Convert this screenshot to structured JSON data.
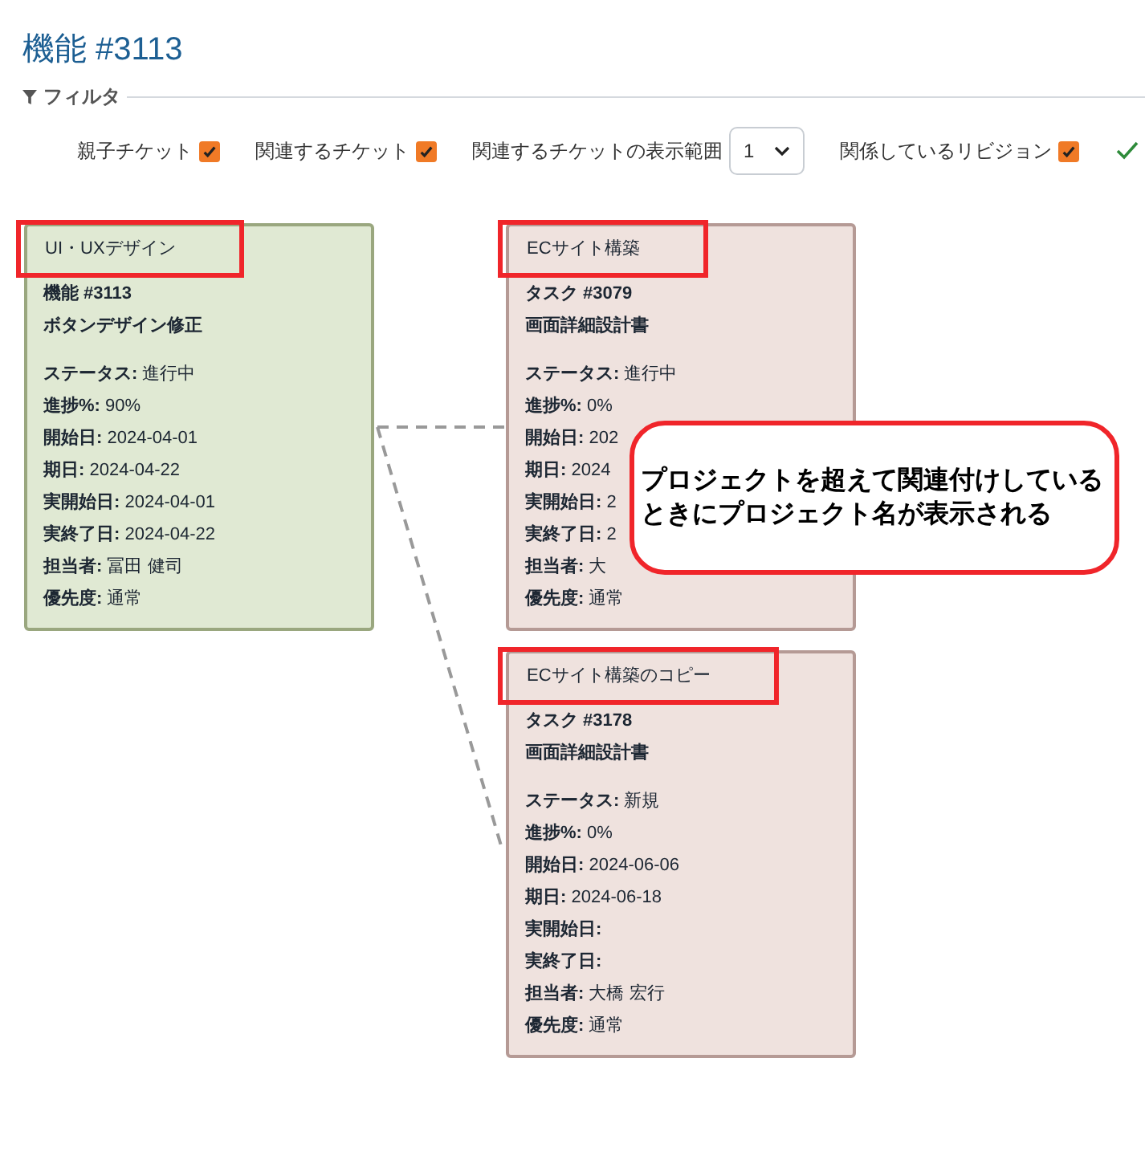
{
  "title": "機能 #3113",
  "filter": {
    "legend": "フィルタ",
    "options": [
      {
        "kind": "checkbox",
        "label": "親子チケット",
        "checked": true
      },
      {
        "kind": "checkbox",
        "label": "関連するチケット",
        "checked": true
      },
      {
        "kind": "select",
        "label": "関連するチケットの表示範囲",
        "value": "1"
      },
      {
        "kind": "checkbox",
        "label": "関係しているリビジョン",
        "checked": true
      }
    ]
  },
  "cards": [
    {
      "kind": "current",
      "project": "UI・UXデザイン",
      "highlighted": true,
      "ticket": "機能 #3113",
      "subject": "ボタンデザイン修正",
      "fields": [
        {
          "label": "ステータス:",
          "value": "進行中"
        },
        {
          "label": "進捗%:",
          "value": "90%"
        },
        {
          "label": "開始日:",
          "value": "2024-04-01"
        },
        {
          "label": "期日:",
          "value": "2024-04-22"
        },
        {
          "label": "実開始日:",
          "value": "2024-04-01"
        },
        {
          "label": "実終了日:",
          "value": "2024-04-22"
        },
        {
          "label": "担当者:",
          "value": "冨田 健司"
        },
        {
          "label": "優先度:",
          "value": "通常"
        }
      ]
    },
    {
      "kind": "related",
      "project": "ECサイト構築",
      "highlighted": true,
      "ticket": "タスク #3079",
      "subject": "画面詳細設計書",
      "fields": [
        {
          "label": "ステータス:",
          "value": "進行中"
        },
        {
          "label": "進捗%:",
          "value": "0%"
        },
        {
          "label": "開始日:",
          "value": "202"
        },
        {
          "label": "期日:",
          "value": "2024"
        },
        {
          "label": "実開始日:",
          "value": "2"
        },
        {
          "label": "実終了日:",
          "value": "2"
        },
        {
          "label": "担当者:",
          "value": "大"
        },
        {
          "label": "優先度:",
          "value": "通常"
        }
      ]
    },
    {
      "kind": "related",
      "project": "ECサイト構築のコピー",
      "highlighted": true,
      "ticket": "タスク #3178",
      "subject": "画面詳細設計書",
      "fields": [
        {
          "label": "ステータス:",
          "value": "新規"
        },
        {
          "label": "進捗%:",
          "value": "0%"
        },
        {
          "label": "開始日:",
          "value": "2024-06-06"
        },
        {
          "label": "期日:",
          "value": "2024-06-18"
        },
        {
          "label": "実開始日:"
        },
        {
          "label": "実終了日:"
        },
        {
          "label": "担当者:",
          "value": "大橋 宏行"
        },
        {
          "label": "優先度:",
          "value": "通常"
        }
      ]
    }
  ],
  "callout": {
    "text": "プロジェクトを超えて関連付けしているときにプロジェクト名が表示される"
  }
}
